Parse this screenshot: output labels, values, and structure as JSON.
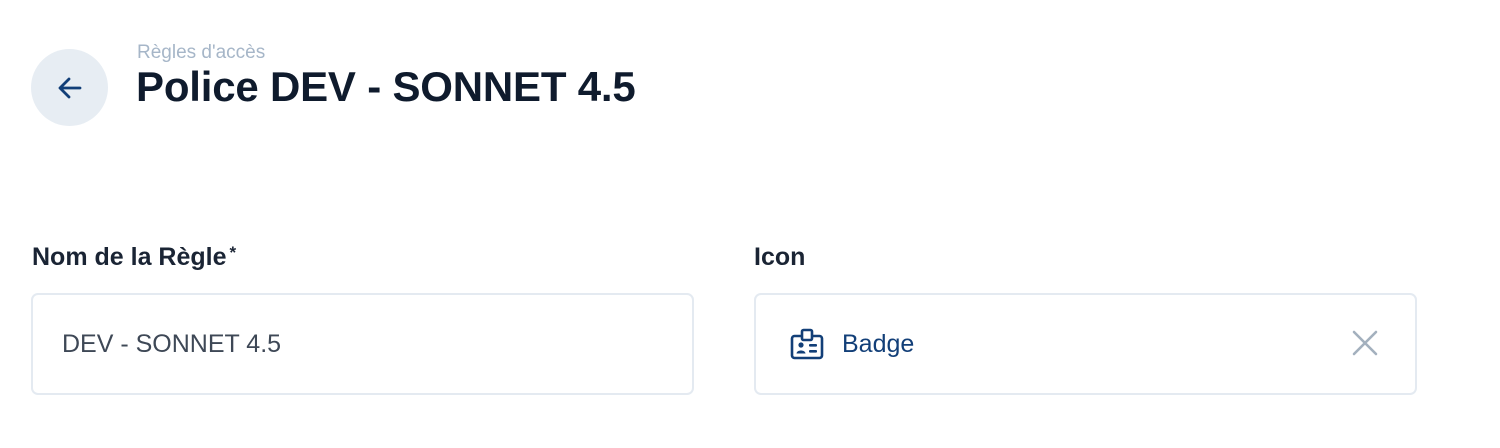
{
  "header": {
    "breadcrumb": "Règles d'accès",
    "title": "Police DEV - SONNET 4.5",
    "back_icon": "arrow-left-icon"
  },
  "form": {
    "name_field": {
      "label": "Nom de la Règle",
      "required_marker": "*",
      "value": "DEV - SONNET 4.5"
    },
    "icon_field": {
      "label": "Icon",
      "value": "Badge",
      "icon": "badge-icon",
      "clear_icon": "close-icon"
    }
  },
  "colors": {
    "primary": "#123f78",
    "title": "#0f1b2d",
    "breadcrumb": "#a6b6c8",
    "back_button_bg": "#e7edf3",
    "field_border": "#e4eaf1"
  }
}
